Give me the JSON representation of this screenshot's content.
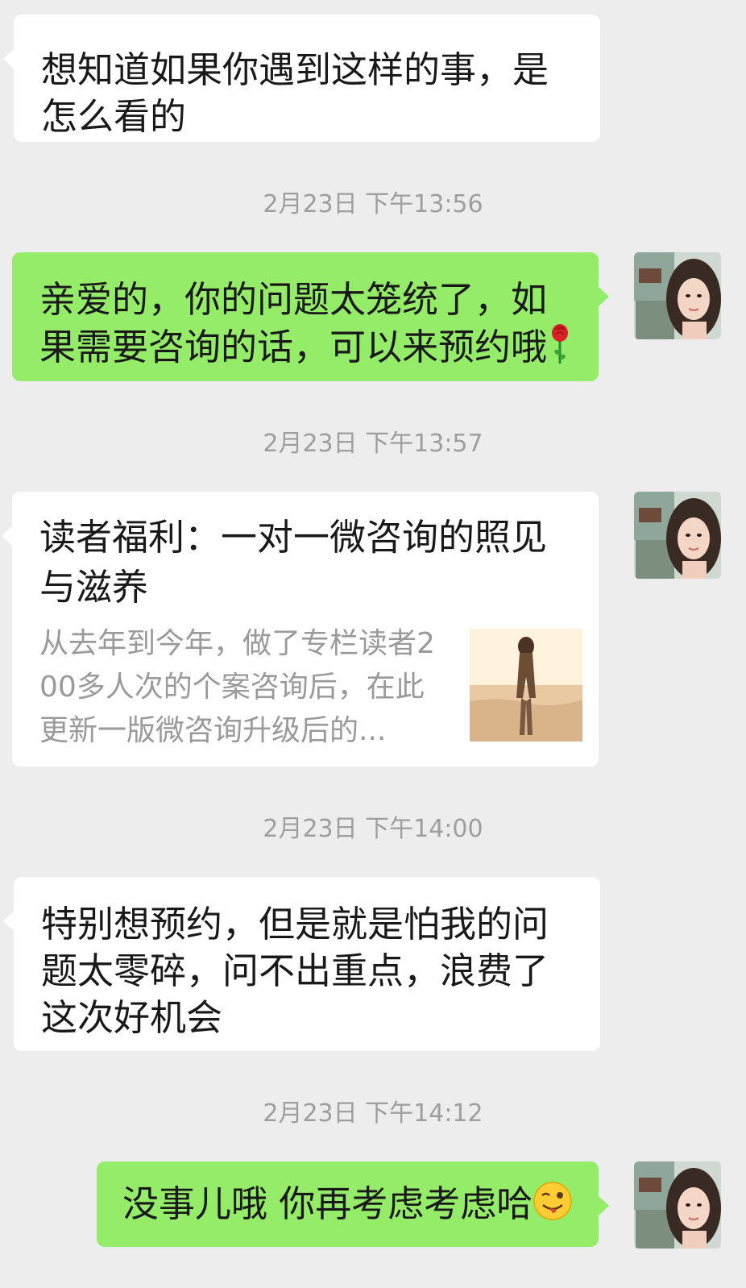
{
  "messages": [
    {
      "text": "想知道如果你遇到这样的事，是怎么看的"
    },
    {
      "time": "2月23日 下午13:56"
    },
    {
      "text": "亲爱的，你的问题太笼统了，如果需要咨询的话，可以来预约哦",
      "emoji": "rose-icon"
    },
    {
      "time": "2月23日 下午13:57"
    },
    {
      "card_title": "读者福利：一对一微咨询的照见与滋养",
      "card_desc": "从去年到今年，做了专栏读者200多人次的个案咨询后，在此更新一版微咨询升级后的..."
    },
    {
      "time": "2月23日 下午14:00"
    },
    {
      "text": "特别想预约，但是就是怕我的问题太零碎，问不出重点，浪费了这次好机会"
    },
    {
      "time": "2月23日 下午14:12"
    },
    {
      "text": "没事儿哦 你再考虑考虑哈",
      "emoji": "winking-tongue-face-icon"
    }
  ],
  "colors": {
    "background": "#ededed",
    "incoming_bubble": "#ffffff",
    "outgoing_bubble": "#95ec69",
    "timestamp": "#9e9e9e"
  }
}
